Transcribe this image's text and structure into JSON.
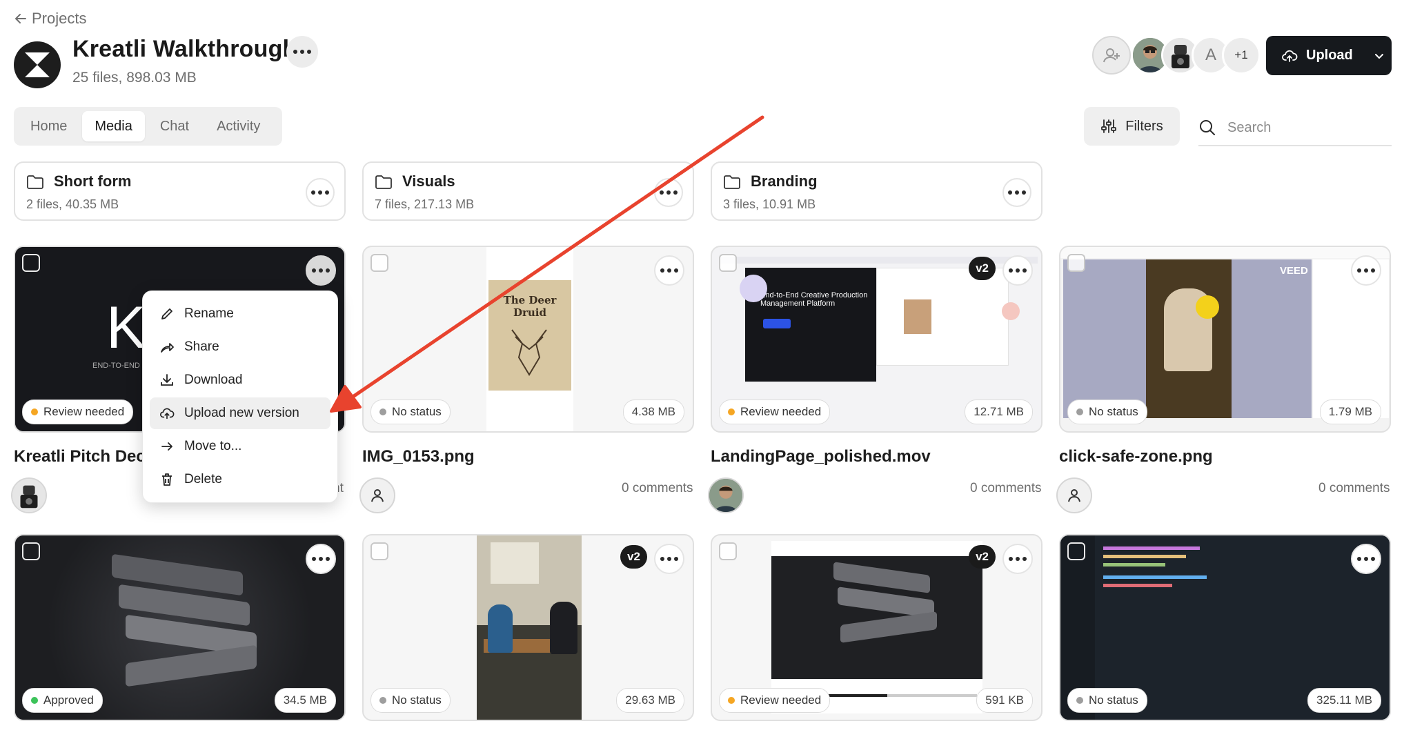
{
  "breadcrumb": {
    "back_label": "Projects"
  },
  "project": {
    "title": "Kreatli Walkthrough",
    "subtitle": "25 files, 898.03 MB"
  },
  "members": {
    "more_count": "+1",
    "initial": "A"
  },
  "upload_button": {
    "label": "Upload"
  },
  "tabs": [
    {
      "label": "Home",
      "active": false
    },
    {
      "label": "Media",
      "active": true
    },
    {
      "label": "Chat",
      "active": false
    },
    {
      "label": "Activity",
      "active": false
    }
  ],
  "toolbar": {
    "filters_label": "Filters",
    "search_placeholder": "Search"
  },
  "folders": [
    {
      "name": "Short form",
      "meta": "2 files, 40.35 MB"
    },
    {
      "name": "Visuals",
      "meta": "7 files, 217.13 MB"
    },
    {
      "name": "Branding",
      "meta": "3 files, 10.91 MB"
    }
  ],
  "files": [
    {
      "name": "Kreatli Pitch Dec",
      "status": "Review needed",
      "status_color": "#f5a623",
      "size": "",
      "comments": "nt",
      "version": "",
      "thumb_text": "K",
      "thumb_sub": "END-TO-END PR"
    },
    {
      "name": "IMG_0153.png",
      "status": "No status",
      "status_color": "#9e9e9e",
      "size": "4.38 MB",
      "comments": "0 comments",
      "version": "",
      "thumb_text": "The Deer Druid"
    },
    {
      "name": "LandingPage_polished.mov",
      "status": "Review needed",
      "status_color": "#f5a623",
      "size": "12.71 MB",
      "comments": "0 comments",
      "version": "v2",
      "thumb_text": "End-to-End Creative Production Management Platform"
    },
    {
      "name": "click-safe-zone.png",
      "status": "No status",
      "status_color": "#9e9e9e",
      "size": "1.79 MB",
      "comments": "0 comments",
      "version": "",
      "thumb_text": "VEED"
    },
    {
      "name": "",
      "status": "Approved",
      "status_color": "#3cc35a",
      "size": "34.5 MB",
      "comments": "",
      "version": ""
    },
    {
      "name": "",
      "status": "No status",
      "status_color": "#9e9e9e",
      "size": "29.63 MB",
      "comments": "",
      "version": "v2"
    },
    {
      "name": "",
      "status": "Review needed",
      "status_color": "#f5a623",
      "size": "591 KB",
      "comments": "",
      "version": "v2"
    },
    {
      "name": "",
      "status": "No status",
      "status_color": "#9e9e9e",
      "size": "325.11 MB",
      "comments": "",
      "version": ""
    }
  ],
  "context_menu": {
    "items": [
      {
        "label": "Rename",
        "icon": "pencil-icon"
      },
      {
        "label": "Share",
        "icon": "share-icon"
      },
      {
        "label": "Download",
        "icon": "download-icon"
      },
      {
        "label": "Upload new version",
        "icon": "cloud-upload-icon",
        "highlighted": true
      },
      {
        "label": "Move to...",
        "icon": "arrow-right-icon"
      },
      {
        "label": "Delete",
        "icon": "trash-icon"
      }
    ]
  },
  "colors": {
    "annotation_arrow": "#e8432e",
    "primary_button": "#16191d"
  }
}
